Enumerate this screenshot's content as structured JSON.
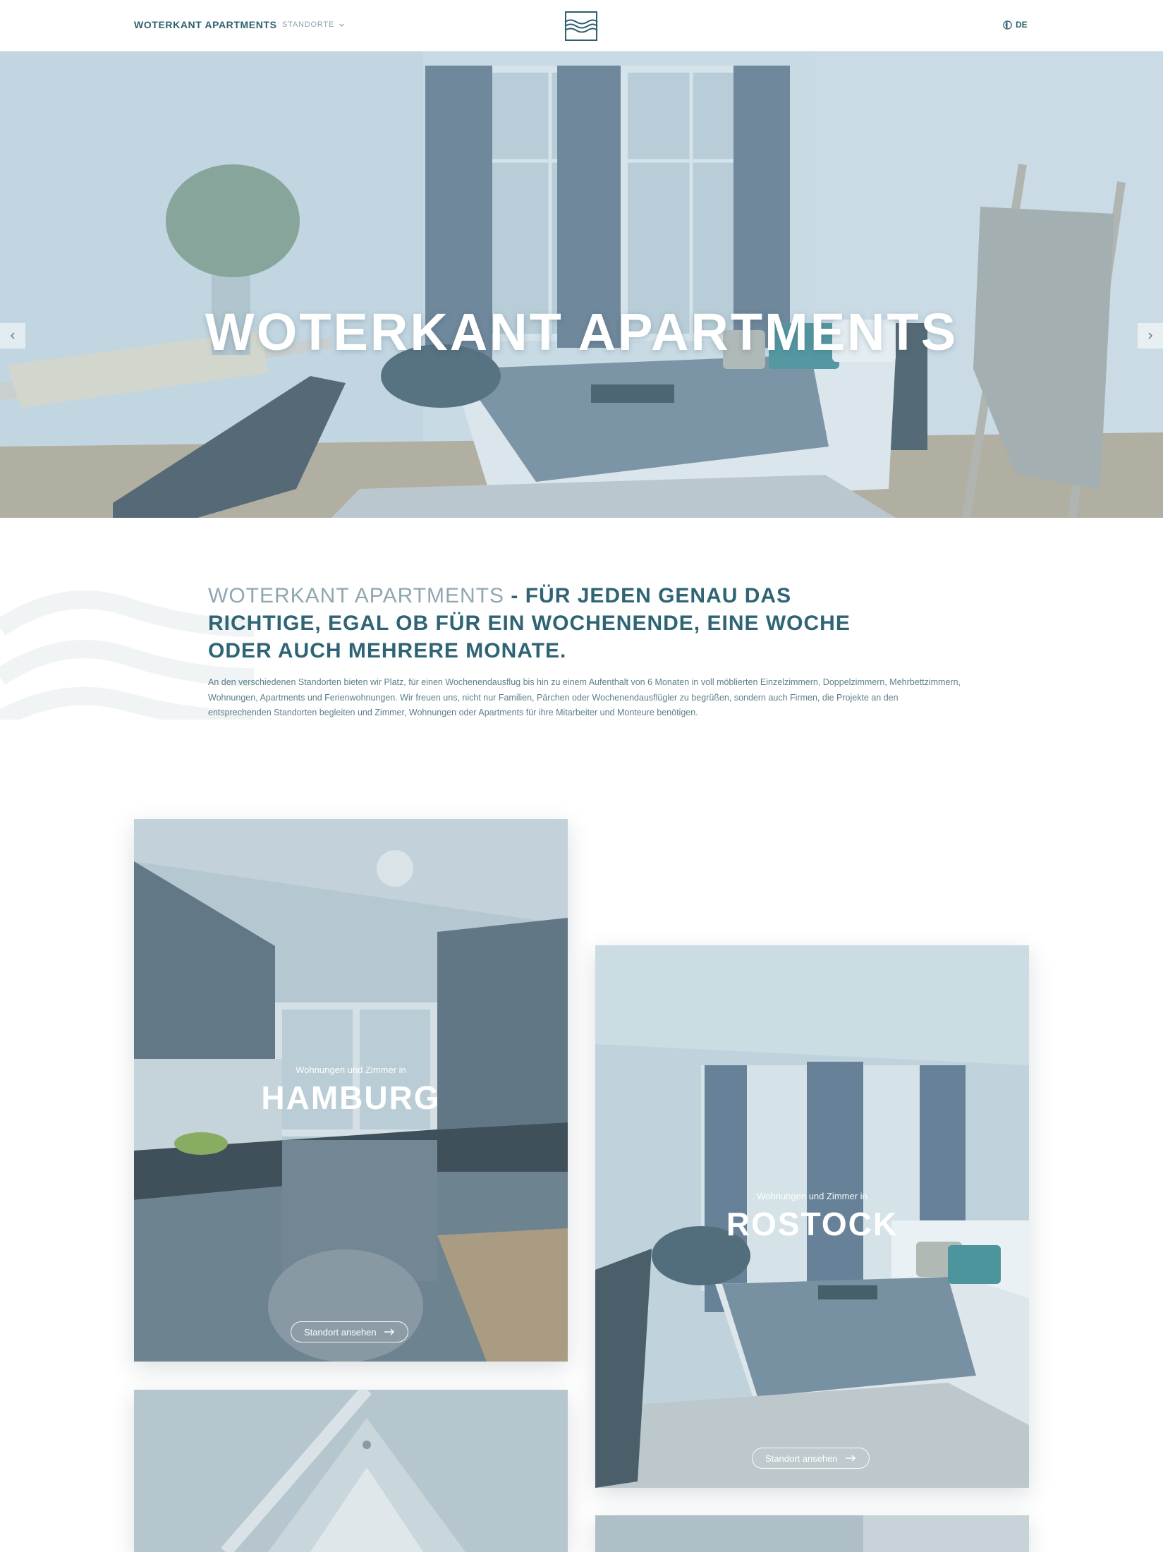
{
  "nav": {
    "brand": "WOTERKANT APARTMENTS",
    "dropdown_label": "STANDORTE",
    "language": "DE",
    "logo": "waves-logo-icon"
  },
  "hero": {
    "title": "WOTERKANT APARTMENTS",
    "prev_icon": "chevron-left-icon",
    "next_icon": "chevron-right-icon"
  },
  "intro": {
    "heading_muted": "WOTERKANT APARTMENTS",
    "heading_main": " - FÜR JEDEN GENAU DAS RICHTIGE, EGAL OB FÜR EIN WOCHENENDE, EINE WOCHE ODER AUCH MEHRERE MONATE.",
    "text": "An den verschiedenen Standorten bieten wir Platz, für einen Wochenendausflug bis hin zu einem Aufenthalt von 6 Monaten in voll möblierten Einzelzimmern, Doppelzimmern, Mehrbettzimmern, Wohnungen, Apartments und Ferienwohnungen. Wir freuen uns, nicht nur Familien, Pärchen oder Wochenendausflügler zu begrüßen, sondern auch Firmen, die Projekte an den entsprechenden Standorten begleiten und Zimmer, Wohnungen oder Apartments für ihre Mitarbeiter und Monteure benötigen."
  },
  "locations": [
    {
      "subtitle": "Wohnungen und Zimmer in",
      "city": "HAMBURG",
      "button": "Standort ansehen"
    },
    {
      "subtitle": "Wohnungen und Zimmer in",
      "city": "ROSTOCK",
      "button": "Standort ansehen"
    }
  ],
  "colors": {
    "brand": "#2f5f6e",
    "muted": "#8fa7b0",
    "overlay": "#9fc0cf"
  }
}
